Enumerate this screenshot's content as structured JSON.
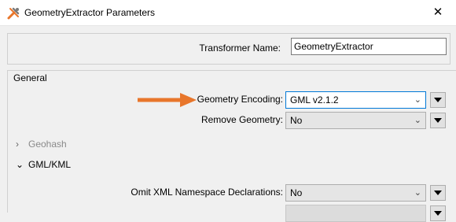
{
  "window": {
    "title": "GeometryExtractor Parameters",
    "icon": "fme-transformer-icon",
    "close_symbol": "✕"
  },
  "transformer": {
    "label": "Transformer Name:",
    "value": "GeometryExtractor"
  },
  "general": {
    "title": "General",
    "fields": [
      {
        "label": "Geometry Encoding:",
        "value": "GML v2.1.2",
        "state": "focused"
      },
      {
        "label": "Remove Geometry:",
        "value": "No",
        "state": "normal"
      }
    ],
    "annotation_arrow_color": "#e8762b"
  },
  "sections": [
    {
      "title": "Geohash",
      "expanded": false,
      "caret": "›"
    },
    {
      "title": "GML/KML",
      "expanded": true,
      "caret": "⌄"
    }
  ],
  "gml_kml": {
    "fields": [
      {
        "label": "Omit XML Namespace Declarations:",
        "value": "No",
        "state": "normal"
      },
      {
        "label": "",
        "value": "",
        "state": "disabled"
      }
    ]
  },
  "colors": {
    "accent": "#0078d7",
    "background": "#f0f0f0"
  }
}
